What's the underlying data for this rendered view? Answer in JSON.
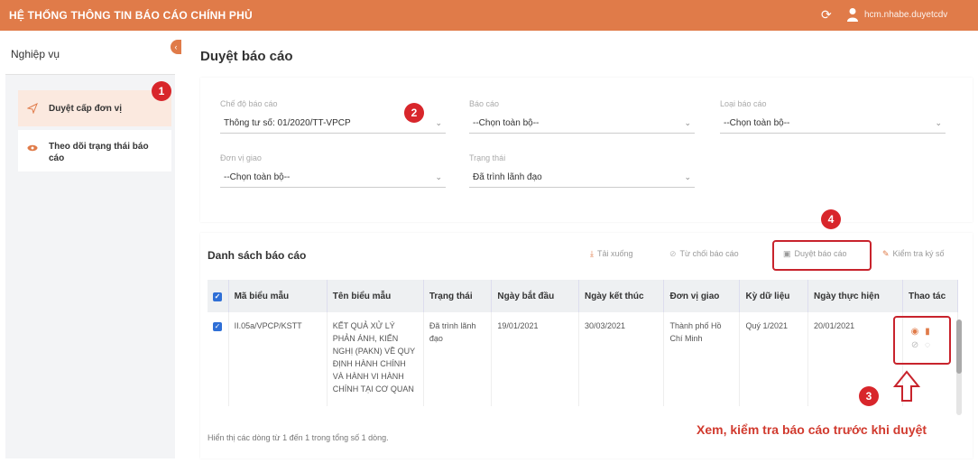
{
  "header": {
    "app_title": "HỆ THỐNG THÔNG TIN BÁO CÁO CHÍNH PHỦ",
    "user_name": "hcm.nhabe.duyetcdv",
    "refresh_icon": "refresh-icon",
    "user_icon": "user-icon"
  },
  "sidebar": {
    "title": "Nghiệp vụ",
    "items": [
      {
        "label": "Duyệt cấp đơn vị",
        "icon": "send-icon",
        "active": true
      },
      {
        "label": "Theo dõi trạng thái báo cáo",
        "icon": "eye-icon",
        "active": false
      }
    ]
  },
  "page_title": "Duyệt báo cáo",
  "filters": {
    "che_do": {
      "label": "Chế độ báo cáo",
      "value": "Thông tư số: 01/2020/TT-VPCP"
    },
    "bao_cao": {
      "label": "Báo cáo",
      "value": "--Chọn toàn bộ--"
    },
    "loai_bao_cao": {
      "label": "Loại báo cáo",
      "value": "--Chọn toàn bộ--"
    },
    "don_vi_giao": {
      "label": "Đơn vị giao",
      "value": "--Chọn toàn bộ--"
    },
    "trang_thai": {
      "label": "Trạng thái",
      "value": "Đã trình lãnh đạo"
    }
  },
  "list": {
    "title": "Danh sách báo cáo",
    "actions": {
      "download": "Tải xuống",
      "reject": "Từ chối báo cáo",
      "approve": "Duyệt báo cáo",
      "verify_signature": "Kiểm tra ký số"
    },
    "columns": [
      "Mã biểu mẫu",
      "Tên biểu mẫu",
      "Trạng thái",
      "Ngày bắt đầu",
      "Ngày kết thúc",
      "Đơn vị giao",
      "Kỳ dữ liệu",
      "Ngày thực hiện",
      "Thao tác"
    ],
    "rows": [
      {
        "ma_bieu_mau": "II.05a/VPCP/KSTT",
        "ten_bieu_mau": "KẾT QUẢ XỬ LÝ PHẢN ÁNH, KIẾN NGHỊ (PAKN) VỀ QUY ĐỊNH HÀNH CHÍNH VÀ HÀNH VI HÀNH CHÍNH TẠI CƠ QUAN",
        "trang_thai": "Đã trình lãnh đạo",
        "ngay_bat_dau": "19/01/2021",
        "ngay_ket_thuc": "30/03/2021",
        "don_vi_giao": "Thành phố Hồ Chí Minh",
        "ky_du_lieu": "Quý 1/2021",
        "ngay_thuc_hien": "20/01/2021"
      }
    ],
    "footer": "Hiển thị các dòng từ 1 đến 1 trong tổng số 1 dòng."
  },
  "annotations": {
    "markers": [
      "1",
      "2",
      "3",
      "4"
    ],
    "caption": "Xem, kiểm tra báo cáo trước khi duyệt"
  },
  "colors": {
    "accent": "#e07b49",
    "marker": "#d8262b",
    "highlight": "#c8232c"
  }
}
